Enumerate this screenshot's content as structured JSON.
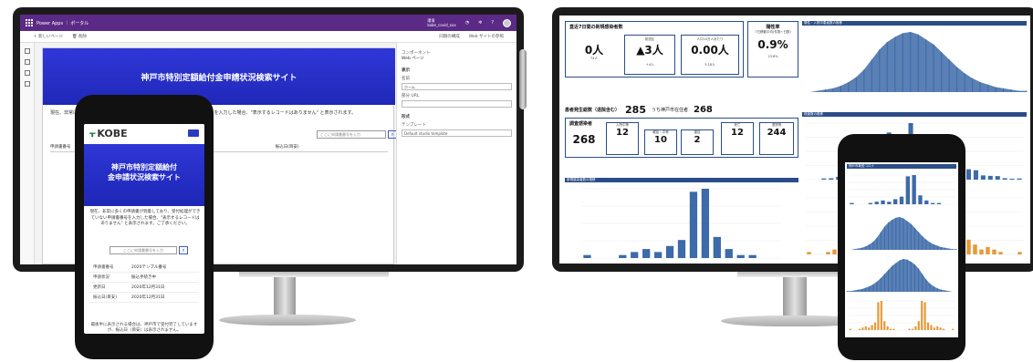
{
  "left_monitor": {
    "app_bar": {
      "title": "Power Apps ｜ ポータル",
      "site_label": "環境",
      "site_name": "kobe_covid_xxx"
    },
    "command_bar": {
      "new_page": "新しいページ",
      "delete": "削除",
      "sync": "同期の構成",
      "browse": "Web サイトの参照"
    },
    "banner_title": "神戸市特別定額給付金申請状況検索サイト",
    "notice": "現在、非常に多くの申請書が到着しており、受付処理ができていない申請書番号を入力した場合、\"表示するレコードはありません\" と表示されます。",
    "search_placeholder": "ここに申請書番号を入力",
    "table_headers": [
      "申請書番号",
      "更新日 ↓",
      "振込日(目安)"
    ],
    "properties": {
      "component_label": "コンポーネント",
      "component_value": "Web ページ",
      "display_section": "表示",
      "name_label": "名前",
      "name_value": "ホーム",
      "url_label": "部分 URL",
      "format_section": "形式",
      "template_label": "テンプレート",
      "template_value": "Default studio template"
    }
  },
  "left_phone": {
    "logo": "KOBE",
    "banner_title_line1": "神戸市特別定額給付",
    "banner_title_line2": "金申請状況検索サイト",
    "notice": "現在、非常に多くの申請書が到着しており、受付処理ができていない申請書番号を入力した場合、\"表示するレコードはありません\" と表示されます。ご了承ください。",
    "search_placeholder": "ここに申請書番号を入力",
    "details": [
      {
        "key": "申請書番号",
        "value": "2020テンプル番号"
      },
      {
        "key": "申請状況",
        "value": "振込手続き中"
      },
      {
        "key": "更新日",
        "value": "2020年12月31日"
      },
      {
        "key": "振込日(目安)",
        "value": "2020年12月31日"
      }
    ],
    "footer": "最後半に表示される場合は、神戸市で受付完了していますが、振込日（目安）は表示されません。"
  },
  "right_monitor": {
    "kpi_title": "直近7日間の新規感染者数",
    "kpi_main": "0人",
    "kpi_main_sub": "74人",
    "kpi_week": "▲3人",
    "kpi_week_label": "前週比",
    "kpi_week_sub": "＋4人",
    "kpi_per100k_label": "人口10万人あたり",
    "kpi_per100k": "0.00人",
    "kpi_per100k_sub": "5.18人",
    "positivity_title": "陽性率",
    "positivity_sub": "7日移動平均(件数÷日数)",
    "positivity_value": "0.9%",
    "positivity_prev": "23.6%",
    "cases_title": "患者発生総数（退院含む）",
    "cases_total": "285",
    "cases_city_label": "うち神戸市在住者",
    "cases_city": "268",
    "hosp_title": "調査感染者",
    "hosp_total": "268",
    "hosp_stats": [
      {
        "label": "入院中等",
        "value": "12"
      },
      {
        "label": "軽症・中等",
        "value": "10"
      },
      {
        "label": "重症",
        "value": "2"
      },
      {
        "label": "死亡",
        "value": "12"
      },
      {
        "label": "退院等",
        "value": "244"
      }
    ],
    "chart_top_title": "陽性・入院中患者数の推移",
    "chart_bottom_title": "新規感染者数の推移",
    "chart_right_title": "検査数の推移"
  },
  "right_phone": {
    "header": "神戸市新型コロナ"
  },
  "chart_data": [
    {
      "type": "bar",
      "title": "新規感染者数の推移",
      "values": [
        1,
        0,
        0,
        1,
        2,
        3,
        2,
        4,
        6,
        22,
        23,
        7,
        3,
        1,
        1,
        0,
        0
      ],
      "color": "#3d6aa8"
    },
    {
      "type": "area",
      "title": "陽性・入院中患者数の推移",
      "values": [
        0,
        0,
        1,
        2,
        3,
        5,
        8,
        12,
        18,
        26,
        34,
        40,
        44,
        47,
        48,
        46,
        42,
        38,
        32,
        26,
        20,
        15,
        11,
        8,
        6,
        4,
        3,
        2,
        1,
        1
      ],
      "color": "#3d6aa8"
    }
  ],
  "colors": {
    "powerapps": "#5b2a86",
    "banner": "#2f36d6",
    "kobe_green": "#2a7a4a",
    "chart_blue": "#3d6aa8",
    "accent_orange": "#e59a3a"
  }
}
